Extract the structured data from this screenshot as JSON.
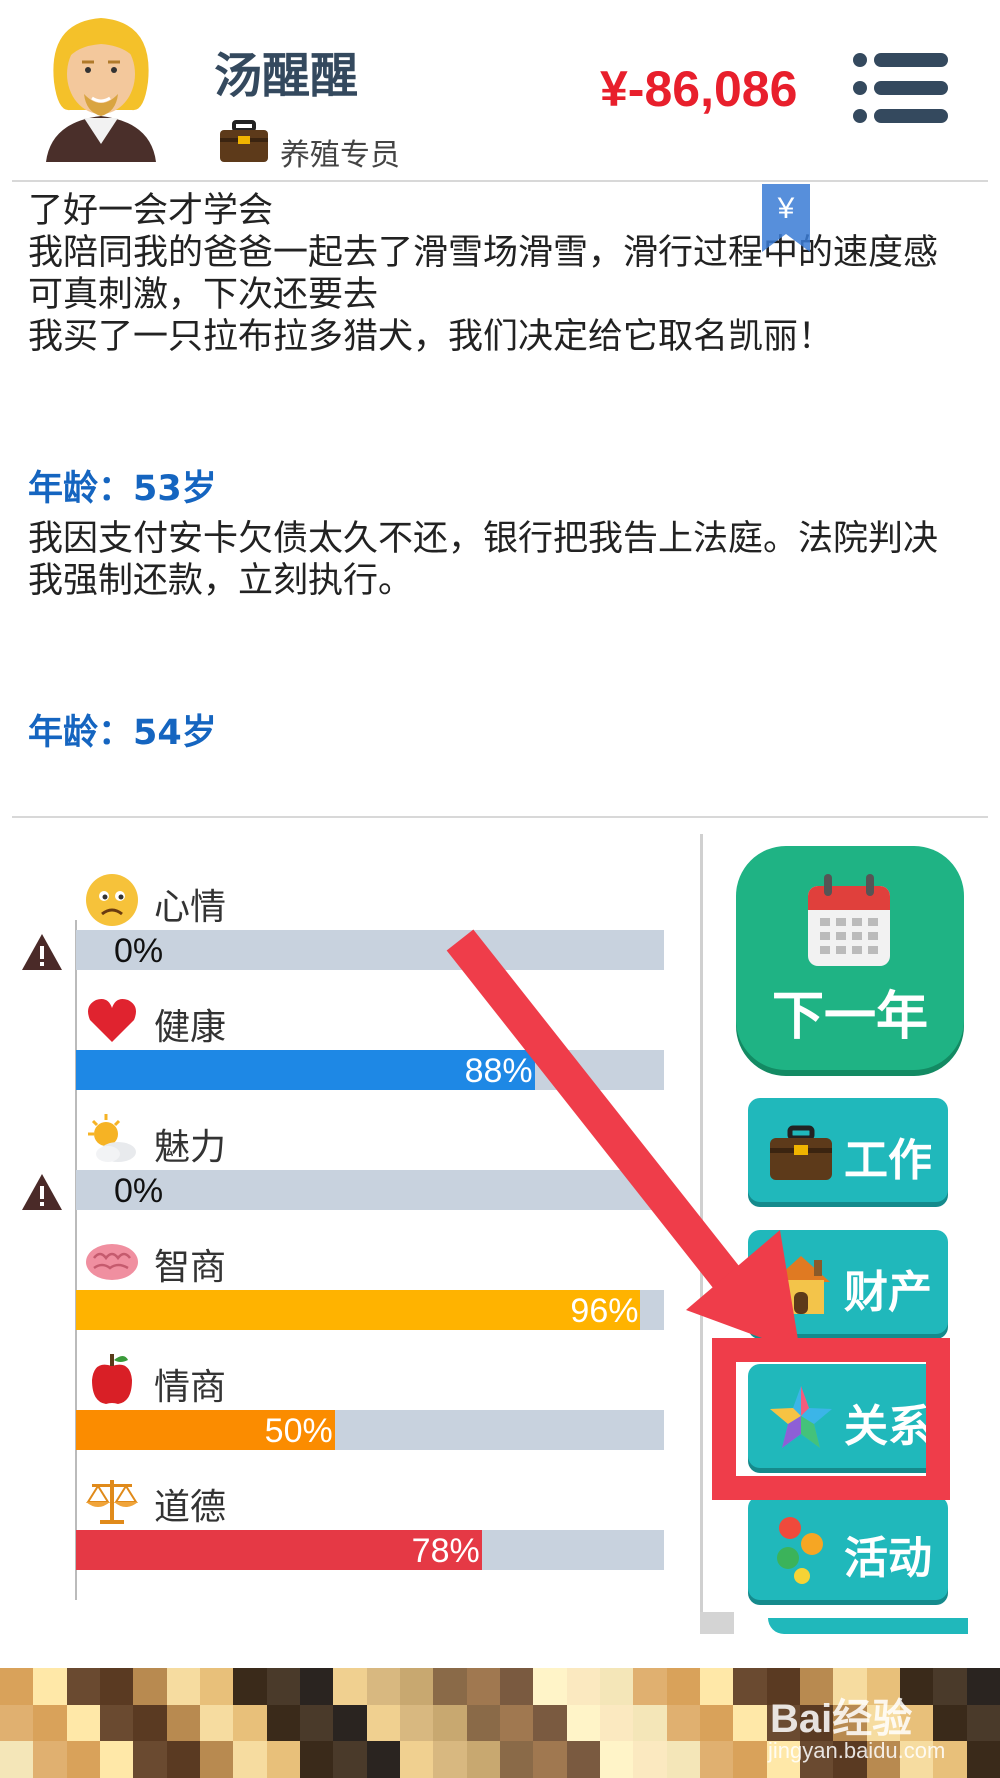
{
  "header": {
    "name": "汤醒醒",
    "job": "养殖专员",
    "money": "¥-86,086"
  },
  "log": {
    "lines": [
      "了好一会才学会",
      "我陪同我的爸爸一起去了滑雪场滑雪，滑行过程中的速度感可真刺激，下次还要去",
      "我买了一只拉布拉多猎犬，我们决定给它取名凯丽！"
    ],
    "age1": "年龄：53岁",
    "event1": "我因支付安卡欠债太久不还，银行把我告上法庭。法院判决我强制还款，立刻执行。",
    "age2": "年龄：54岁",
    "money_tab_symbol": "¥"
  },
  "stats": [
    {
      "label": "心情",
      "value": "0%",
      "fraction": 0.0,
      "color": "#c8d2de",
      "icon": "sad-face-icon",
      "warning": true
    },
    {
      "label": "健康",
      "value": "88%",
      "fraction": 0.78,
      "color": "#1e88e5",
      "icon": "heart-icon",
      "warning": false
    },
    {
      "label": "魅力",
      "value": "0%",
      "fraction": 0.0,
      "color": "#c8d2de",
      "icon": "sun-cloud-icon",
      "warning": true
    },
    {
      "label": "智商",
      "value": "96%",
      "fraction": 0.96,
      "color": "#ffb300",
      "icon": "brain-icon",
      "warning": false
    },
    {
      "label": "情商",
      "value": "50%",
      "fraction": 0.44,
      "color": "#fb8c00",
      "icon": "apple-icon",
      "warning": false
    },
    {
      "label": "道德",
      "value": "78%",
      "fraction": 0.69,
      "color": "#e53945",
      "icon": "scales-icon",
      "warning": false
    }
  ],
  "buttons": {
    "next_year": "下一年",
    "work": "工作",
    "property": "财产",
    "relations": "关系",
    "activity": "活动"
  },
  "watermark": {
    "main": "Bai经验",
    "sub": "jingyan.baidu.com"
  },
  "colors": {
    "money_red": "#e81f2c",
    "age_blue": "#1565c0",
    "annotation_red": "#ef3d4a",
    "button_teal": "#20b8bb",
    "button_green": "#1fb384"
  }
}
